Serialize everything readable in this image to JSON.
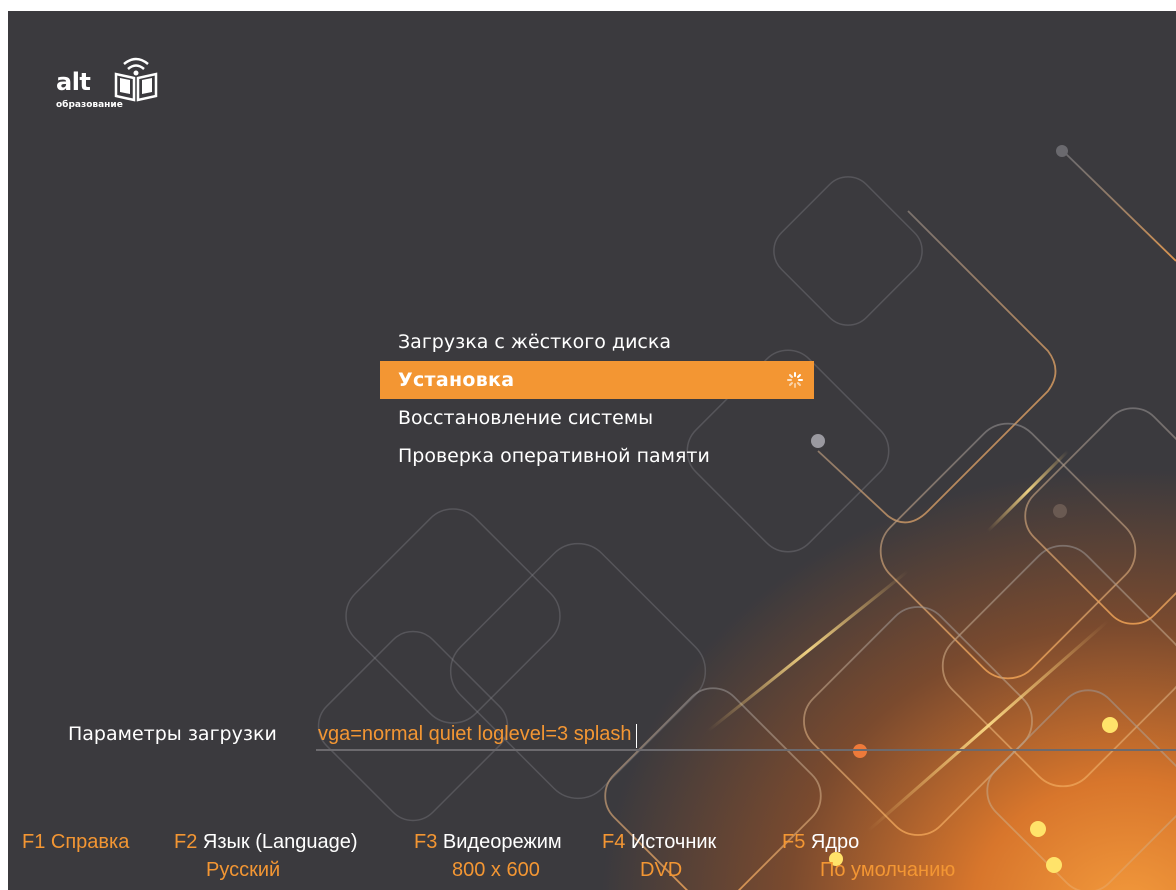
{
  "logo": {
    "word": "alt",
    "subtitle": "образование",
    "icon": "book-wifi-icon"
  },
  "menu": {
    "items": [
      {
        "label": "Загрузка с жёсткого диска",
        "selected": false
      },
      {
        "label": "Установка",
        "selected": true
      },
      {
        "label": "Восстановление системы",
        "selected": false
      },
      {
        "label": "Проверка оперативной памяти",
        "selected": false
      }
    ],
    "spinner_icon": "loading-spinner-icon"
  },
  "boot_params": {
    "label": "Параметры загрузки",
    "value": "vga=normal quiet loglevel=3 splash"
  },
  "fkeys": [
    {
      "key": "F1",
      "title": "Справка",
      "value": ""
    },
    {
      "key": "F2",
      "title": "Язык (Language)",
      "value": "Русский"
    },
    {
      "key": "F3",
      "title": "Видеорежим",
      "value": "800 x 600"
    },
    {
      "key": "F4",
      "title": "Источник",
      "value": "DVD"
    },
    {
      "key": "F5",
      "title": "Ядро",
      "value": "По умолчанию"
    }
  ],
  "colors": {
    "accent": "#f39633",
    "background": "#39383d",
    "text": "#ffffff"
  }
}
